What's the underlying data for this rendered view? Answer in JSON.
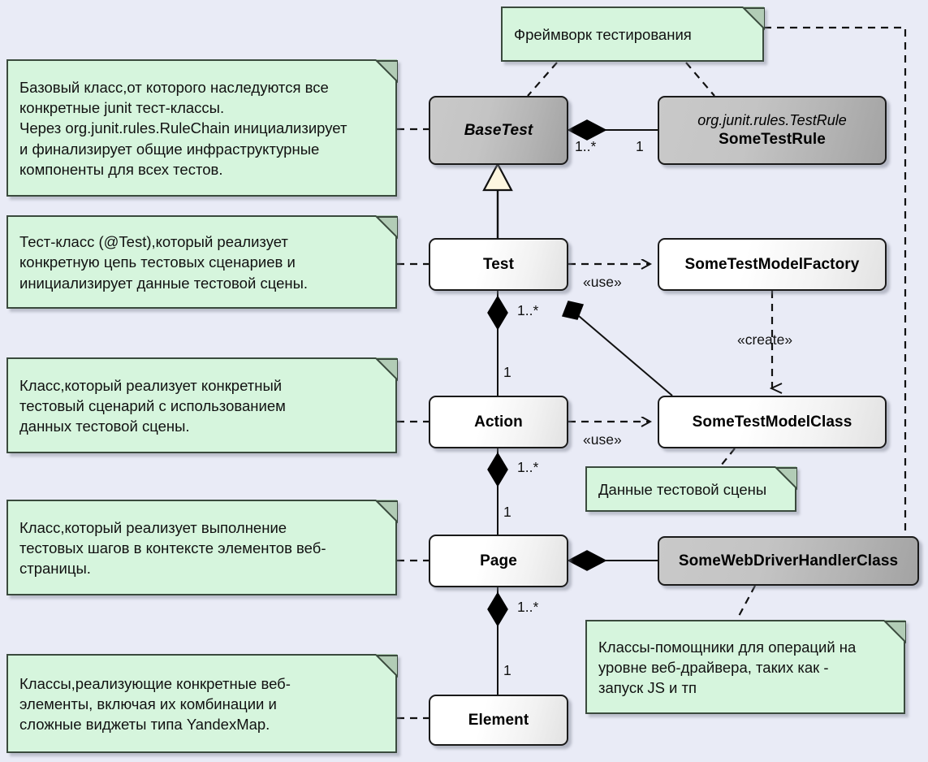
{
  "diagram": {
    "title": "UML class diagram: test automation framework",
    "background_color": "#e9ebf6",
    "note_fill": "#d6f5dd",
    "note_border": "#3a4a3d",
    "class_gray_fill": "#b8b8b8",
    "class_light_fill": "#ffffff",
    "line_color": "#111111"
  },
  "classes": [
    {
      "id": "basetest",
      "name": "BaseTest",
      "stereotype": "",
      "style": "gray",
      "italic": true
    },
    {
      "id": "sometestrule",
      "name": "SomeTestRule",
      "stereotype": "org.junit.rules.TestRule",
      "style": "gray",
      "italic": false
    },
    {
      "id": "test",
      "name": "Test",
      "stereotype": "",
      "style": "light",
      "italic": false
    },
    {
      "id": "sometestmodelfactory",
      "name": "SomeTestModelFactory",
      "stereotype": "",
      "style": "light",
      "italic": false
    },
    {
      "id": "action",
      "name": "Action",
      "stereotype": "",
      "style": "light",
      "italic": false
    },
    {
      "id": "sometestmodelclass",
      "name": "SomeTestModelClass",
      "stereotype": "",
      "style": "light",
      "italic": false
    },
    {
      "id": "page",
      "name": "Page",
      "stereotype": "",
      "style": "light",
      "italic": false
    },
    {
      "id": "somewebdriverhandlerclass",
      "name": "SomeWebDriverHandlerClass",
      "stereotype": "",
      "style": "gray",
      "italic": false
    },
    {
      "id": "element",
      "name": "Element",
      "stereotype": "",
      "style": "light",
      "italic": false
    }
  ],
  "notes": [
    {
      "id": "note-framework",
      "text": "Фреймворк тестирования"
    },
    {
      "id": "note-basetest",
      "text": "Базовый класс,от которого наследуются все\nконкретные junit тест-классы.\nЧерез org.junit.rules.RuleChain инициализирует\nи финализирует общие инфраструктурные\nкомпоненты для всех тестов."
    },
    {
      "id": "note-test",
      "text": "Тест-класс (@Test),который реализует\nконкретную цепь тестовых сценариев и\nинициализирует данные тестовой сцены."
    },
    {
      "id": "note-action",
      "text": "Класс,который реализует конкретный\nтестовый сценарий с использованием\nданных тестовой сцены."
    },
    {
      "id": "note-page",
      "text": "Класс,который реализует выполнение\nтестовых шагов в контексте элементов веб-\nстраницы."
    },
    {
      "id": "note-element",
      "text": "Классы,реализующие конкретные веб-\nэлементы, включая их комбинации и\nсложные виджеты типа YandexMap."
    },
    {
      "id": "note-scenedata",
      "text": "Данные тестовой сцены"
    },
    {
      "id": "note-webdriver",
      "text": "Классы-помощники для операций на\nуровне веб-драйвера, таких как -\nзапуск JS и тп"
    }
  ],
  "edge_labels": {
    "basetest_rule_many": "1..*",
    "basetest_rule_one": "1",
    "test_use": "«use»",
    "factory_create": "«create»",
    "test_action_many": "1..*",
    "test_action_one": "1",
    "action_use": "«use»",
    "action_page_many": "1..*",
    "action_page_one": "1",
    "page_element_many": "1..*",
    "page_element_one": "1"
  }
}
